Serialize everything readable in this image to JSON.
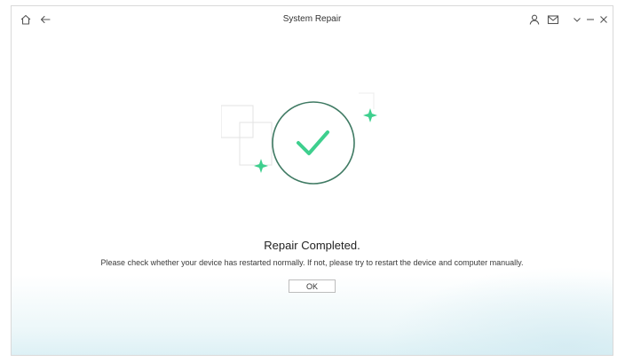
{
  "window": {
    "title": "System Repair"
  },
  "titlebar": {
    "home_icon": "home-icon",
    "back_icon": "back-arrow-icon",
    "account_icon": "user-icon",
    "mail_icon": "mail-icon",
    "dropdown_icon": "chevron-down-icon",
    "minimize_icon": "minimize-icon",
    "close_icon": "close-icon"
  },
  "result": {
    "heading": "Repair Completed.",
    "message": "Please check whether your device has restarted normally. If not, please try to restart the device and computer manually.",
    "ok_label": "OK",
    "status_icon": "check-circle-icon"
  },
  "colors": {
    "accent_green": "#3ecf8e",
    "circle_stroke": "#3f7a63",
    "frame_stroke": "#e3e3e3"
  }
}
